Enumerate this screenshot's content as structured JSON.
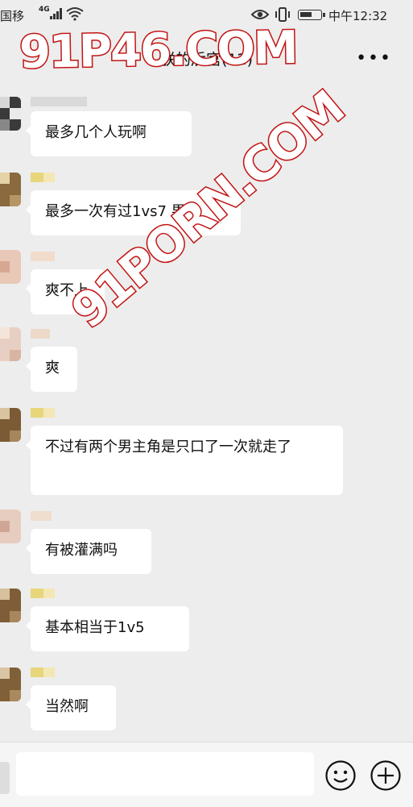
{
  "status_bar": {
    "carrier": "国移",
    "network": "4G",
    "time": "中午12:32"
  },
  "header": {
    "title": "朕的后宫(12)",
    "more_icon": "more-dots-icon"
  },
  "messages": [
    {
      "text": "最多几个人玩啊"
    },
    {
      "text": "最多一次有过1vs7 男"
    },
    {
      "text": "爽不上"
    },
    {
      "text": "爽"
    },
    {
      "text": "不过有两个男主角是只口了一次就走了"
    },
    {
      "text": "有被灌满吗"
    },
    {
      "text": "基本相当于1v5"
    },
    {
      "text": "当然啊"
    }
  ],
  "watermarks": [
    "91P46.COM",
    "91PORN.COM"
  ],
  "colors": {
    "background": "#ededed",
    "bubble": "#ffffff",
    "watermark_stroke": "#c21313"
  }
}
